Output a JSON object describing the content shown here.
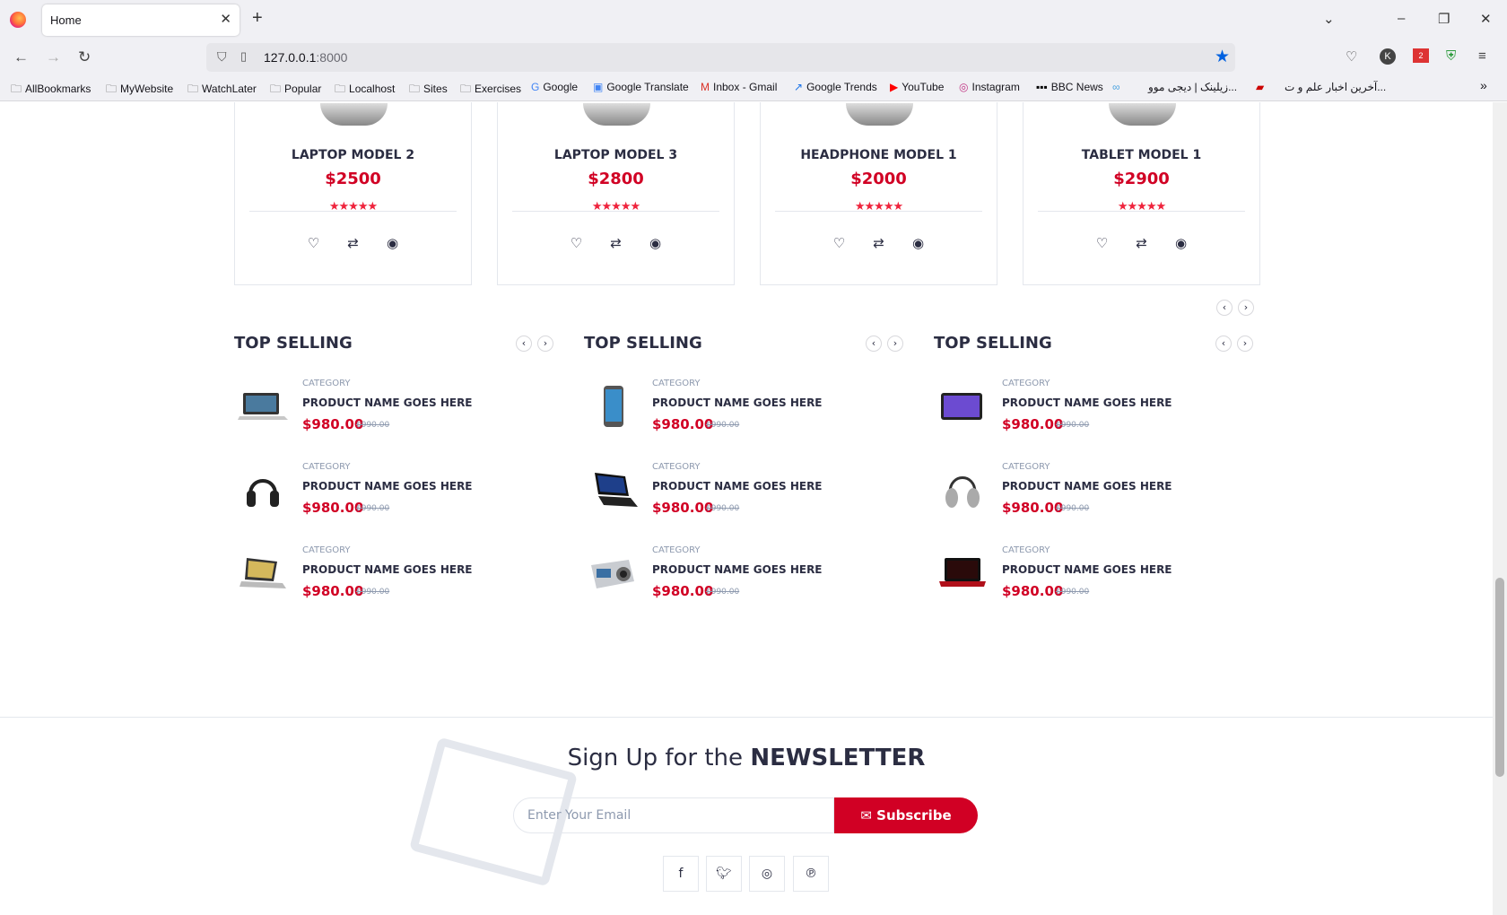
{
  "browser": {
    "tab_title": "Home",
    "url_host": "127.0.0.1",
    "url_port": ":8000",
    "ext_badge": "2",
    "bookmarks": [
      "AllBookmarks",
      "MyWebsite",
      "WatchLater",
      "Popular",
      "Localhost",
      "Sites",
      "Exercises",
      "Google",
      "Google Translate",
      "Inbox - Gmail",
      "Google Trends",
      "YouTube",
      "Instagram",
      "BBC News",
      "زیلینک | دیجی موو...",
      "آخرین اخبار علم و ت..."
    ]
  },
  "products": [
    {
      "name": "LAPTOP MODEL 2",
      "price": "$2500",
      "rating": 5
    },
    {
      "name": "LAPTOP MODEL 3",
      "price": "$2800",
      "rating": 5
    },
    {
      "name": "HEADPHONE MODEL 1",
      "price": "$2000",
      "rating": 5
    },
    {
      "name": "TABLET MODEL 1",
      "price": "$2900",
      "rating": 5
    }
  ],
  "top_selling": [
    {
      "title": "TOP SELLING",
      "items": [
        {
          "image": "laptop",
          "category": "CATEGORY",
          "name": "PRODUCT NAME GOES HERE",
          "price": "$980.00",
          "old": "$990.00"
        },
        {
          "image": "headphones",
          "category": "CATEGORY",
          "name": "PRODUCT NAME GOES HERE",
          "price": "$980.00",
          "old": "$990.00"
        },
        {
          "image": "laptop",
          "category": "CATEGORY",
          "name": "PRODUCT NAME GOES HERE",
          "price": "$980.00",
          "old": "$990.00"
        }
      ]
    },
    {
      "title": "TOP SELLING",
      "items": [
        {
          "image": "phone",
          "category": "CATEGORY",
          "name": "PRODUCT NAME GOES HERE",
          "price": "$980.00",
          "old": "$990.00"
        },
        {
          "image": "laptop",
          "category": "CATEGORY",
          "name": "PRODUCT NAME GOES HERE",
          "price": "$980.00",
          "old": "$990.00"
        },
        {
          "image": "camera",
          "category": "CATEGORY",
          "name": "PRODUCT NAME GOES HERE",
          "price": "$980.00",
          "old": "$990.00"
        }
      ]
    },
    {
      "title": "TOP SELLING",
      "items": [
        {
          "image": "tablet",
          "category": "CATEGORY",
          "name": "PRODUCT NAME GOES HERE",
          "price": "$980.00",
          "old": "$990.00"
        },
        {
          "image": "headphones",
          "category": "CATEGORY",
          "name": "PRODUCT NAME GOES HERE",
          "price": "$980.00",
          "old": "$990.00"
        },
        {
          "image": "laptop",
          "category": "CATEGORY",
          "name": "PRODUCT NAME GOES HERE",
          "price": "$980.00",
          "old": "$990.00"
        }
      ]
    }
  ],
  "newsletter": {
    "title_pre": "Sign Up for the ",
    "title_bold": "NEWSLETTER",
    "placeholder": "Enter Your Email",
    "button": "Subscribe"
  },
  "colors": {
    "accent": "#d10024",
    "dark": "#2b2d42",
    "muted": "#8d99ae"
  }
}
